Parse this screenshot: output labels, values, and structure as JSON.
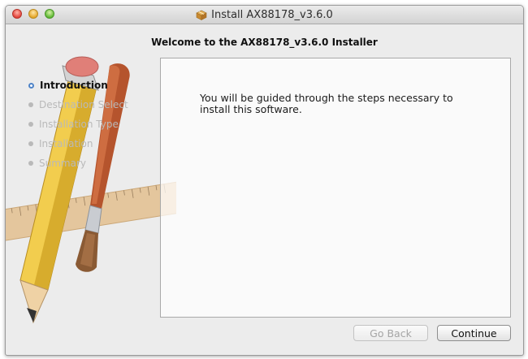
{
  "window": {
    "title": "Install AX88178_v3.6.0"
  },
  "header": {
    "subtitle": "Welcome to the AX88178_v3.6.0 Installer"
  },
  "sidebar": {
    "steps": [
      {
        "label": "Introduction",
        "active": true
      },
      {
        "label": "Destination Select",
        "active": false
      },
      {
        "label": "Installation Type",
        "active": false
      },
      {
        "label": "Installation",
        "active": false
      },
      {
        "label": "Summary",
        "active": false
      }
    ]
  },
  "content": {
    "body": "You will be guided through the steps necessary to install this software."
  },
  "buttons": {
    "back": "Go Back",
    "continue": "Continue"
  },
  "icons": {
    "title": "package-icon",
    "hero": "installer-pencil-brush-ruler-icon"
  }
}
